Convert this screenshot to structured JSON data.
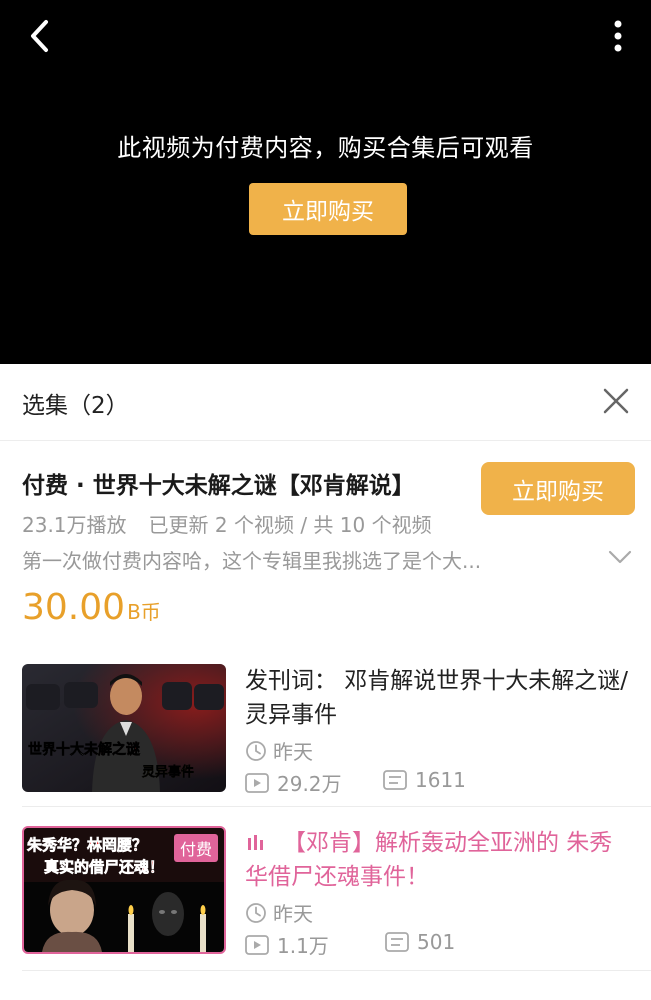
{
  "video": {
    "paywall_message": "此视频为付费内容，购买合集后可观看",
    "buy_button": "立即购买"
  },
  "panel": {
    "title": "选集（2）",
    "collection": {
      "title": "付费 · 世界十大未解之谜【邓肯解说】",
      "buy_button": "立即购买",
      "plays": "23.1万播放",
      "updated": "已更新 2 个视频 / 共 10 个视频",
      "description": "第一次做付费内容哈，这个专辑里我挑选了是个大...",
      "price": "30.00",
      "price_unit": "B币"
    },
    "items": [
      {
        "title": "发刊词： 邓肯解说世界十大未解之谜/灵异事件",
        "date": "昨天",
        "views": "29.2万",
        "comments": "1611",
        "thumb_text_1a": "世界十大",
        "thumb_text_1b": "未解之谜",
        "thumb_text_2": "灵异事件"
      },
      {
        "title": "【邓肯】解析轰动全亚洲的 朱秀华借尸还魂事件！",
        "date": "昨天",
        "views": "1.1万",
        "comments": "501",
        "badge": "付费",
        "thumb_text_1": "朱秀华？林罔腰？",
        "thumb_text_2": "真实的借尸还魂！"
      }
    ]
  },
  "colors": {
    "accent": "#F0B24A",
    "price": "#E8A02A",
    "playing": "#E0649A",
    "muted": "#999999"
  }
}
